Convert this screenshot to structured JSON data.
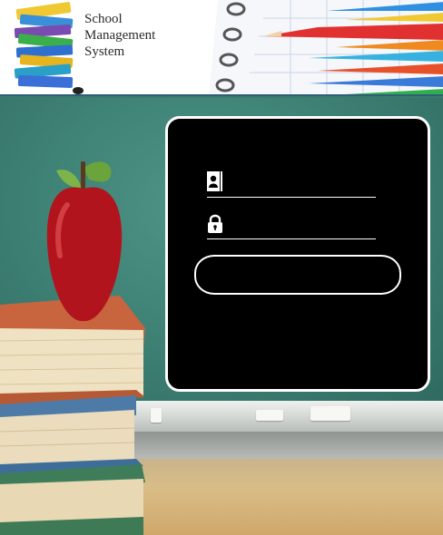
{
  "header": {
    "title_lines": [
      "School",
      "Management",
      "System"
    ],
    "logo_icon": "books-stack-icon",
    "decor_image": "notebook-pencils-icon"
  },
  "login": {
    "username": {
      "icon": "user-card-icon",
      "value": "",
      "placeholder": ""
    },
    "password": {
      "icon": "lock-icon",
      "value": "",
      "placeholder": ""
    },
    "submit_label": ""
  },
  "scene": {
    "icons": [
      "apple-icon",
      "book-stack-icon",
      "chalk-icon"
    ]
  },
  "colors": {
    "panel_bg": "#000000",
    "panel_border": "#ffffff",
    "board": "#3f8276",
    "header_rule": "#2f5d7a"
  }
}
